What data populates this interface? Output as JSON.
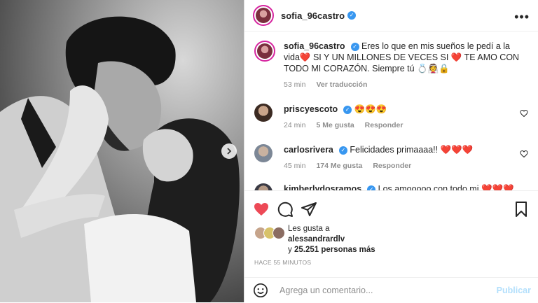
{
  "post": {
    "username": "sofia_96castro",
    "more_icon": "more-horizontal-icon"
  },
  "caption": {
    "username": "sofia_96castro",
    "text": "Eres lo que en mis sueños le pedí a la vida❤️ SI Y UN MILLONES DE VECES SI ❤️ TE AMO CON TODO MI CORAZÓN. Siempre tú 💍👰🔒",
    "time": "53 min",
    "translate": "Ver traducción"
  },
  "comments": [
    {
      "username": "priscyescoto",
      "text": "😍😍😍",
      "time": "24 min",
      "likes": "5 Me gusta",
      "reply": "Responder"
    },
    {
      "username": "carlosrivera",
      "text": "Felicidades primaaaa!! ❤️❤️❤️",
      "time": "45 min",
      "likes": "174 Me gusta",
      "reply": "Responder"
    },
    {
      "username": "kimberlydosramos",
      "text": "Los amooooo con todo mi ❤️❤️❤️",
      "time": "",
      "likes": "",
      "reply": ""
    }
  ],
  "likes": {
    "prefix": "Les gusta a",
    "user": "alessandrardlv",
    "rest_prefix": "y",
    "count": "25.251",
    "rest_suffix": "personas más"
  },
  "timestamp": "HACE 55 MINUTOS",
  "add_comment": {
    "placeholder": "Agrega un comentario...",
    "publish": "Publicar"
  },
  "colors": {
    "like_red": "#ed4956",
    "verified_blue": "#3897f0",
    "publish_disabled": "#b2dffc"
  }
}
